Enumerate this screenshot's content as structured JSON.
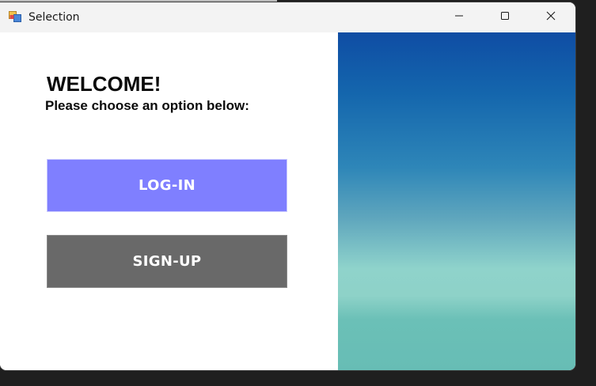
{
  "window": {
    "title": "Selection"
  },
  "form": {
    "heading": "WELCOME!",
    "subheading": "Please choose an option below:",
    "login_label": "LOG-IN",
    "signup_label": "SIGN-UP"
  },
  "colors": {
    "login_button": "#7f7fff",
    "signup_button": "#696969",
    "gradient_top": "#0f4da4",
    "gradient_bottom": "#67bdb5"
  },
  "icons": {
    "app": "app-form-icon",
    "minimize": "minimize-icon",
    "maximize": "maximize-icon",
    "close": "close-icon"
  }
}
